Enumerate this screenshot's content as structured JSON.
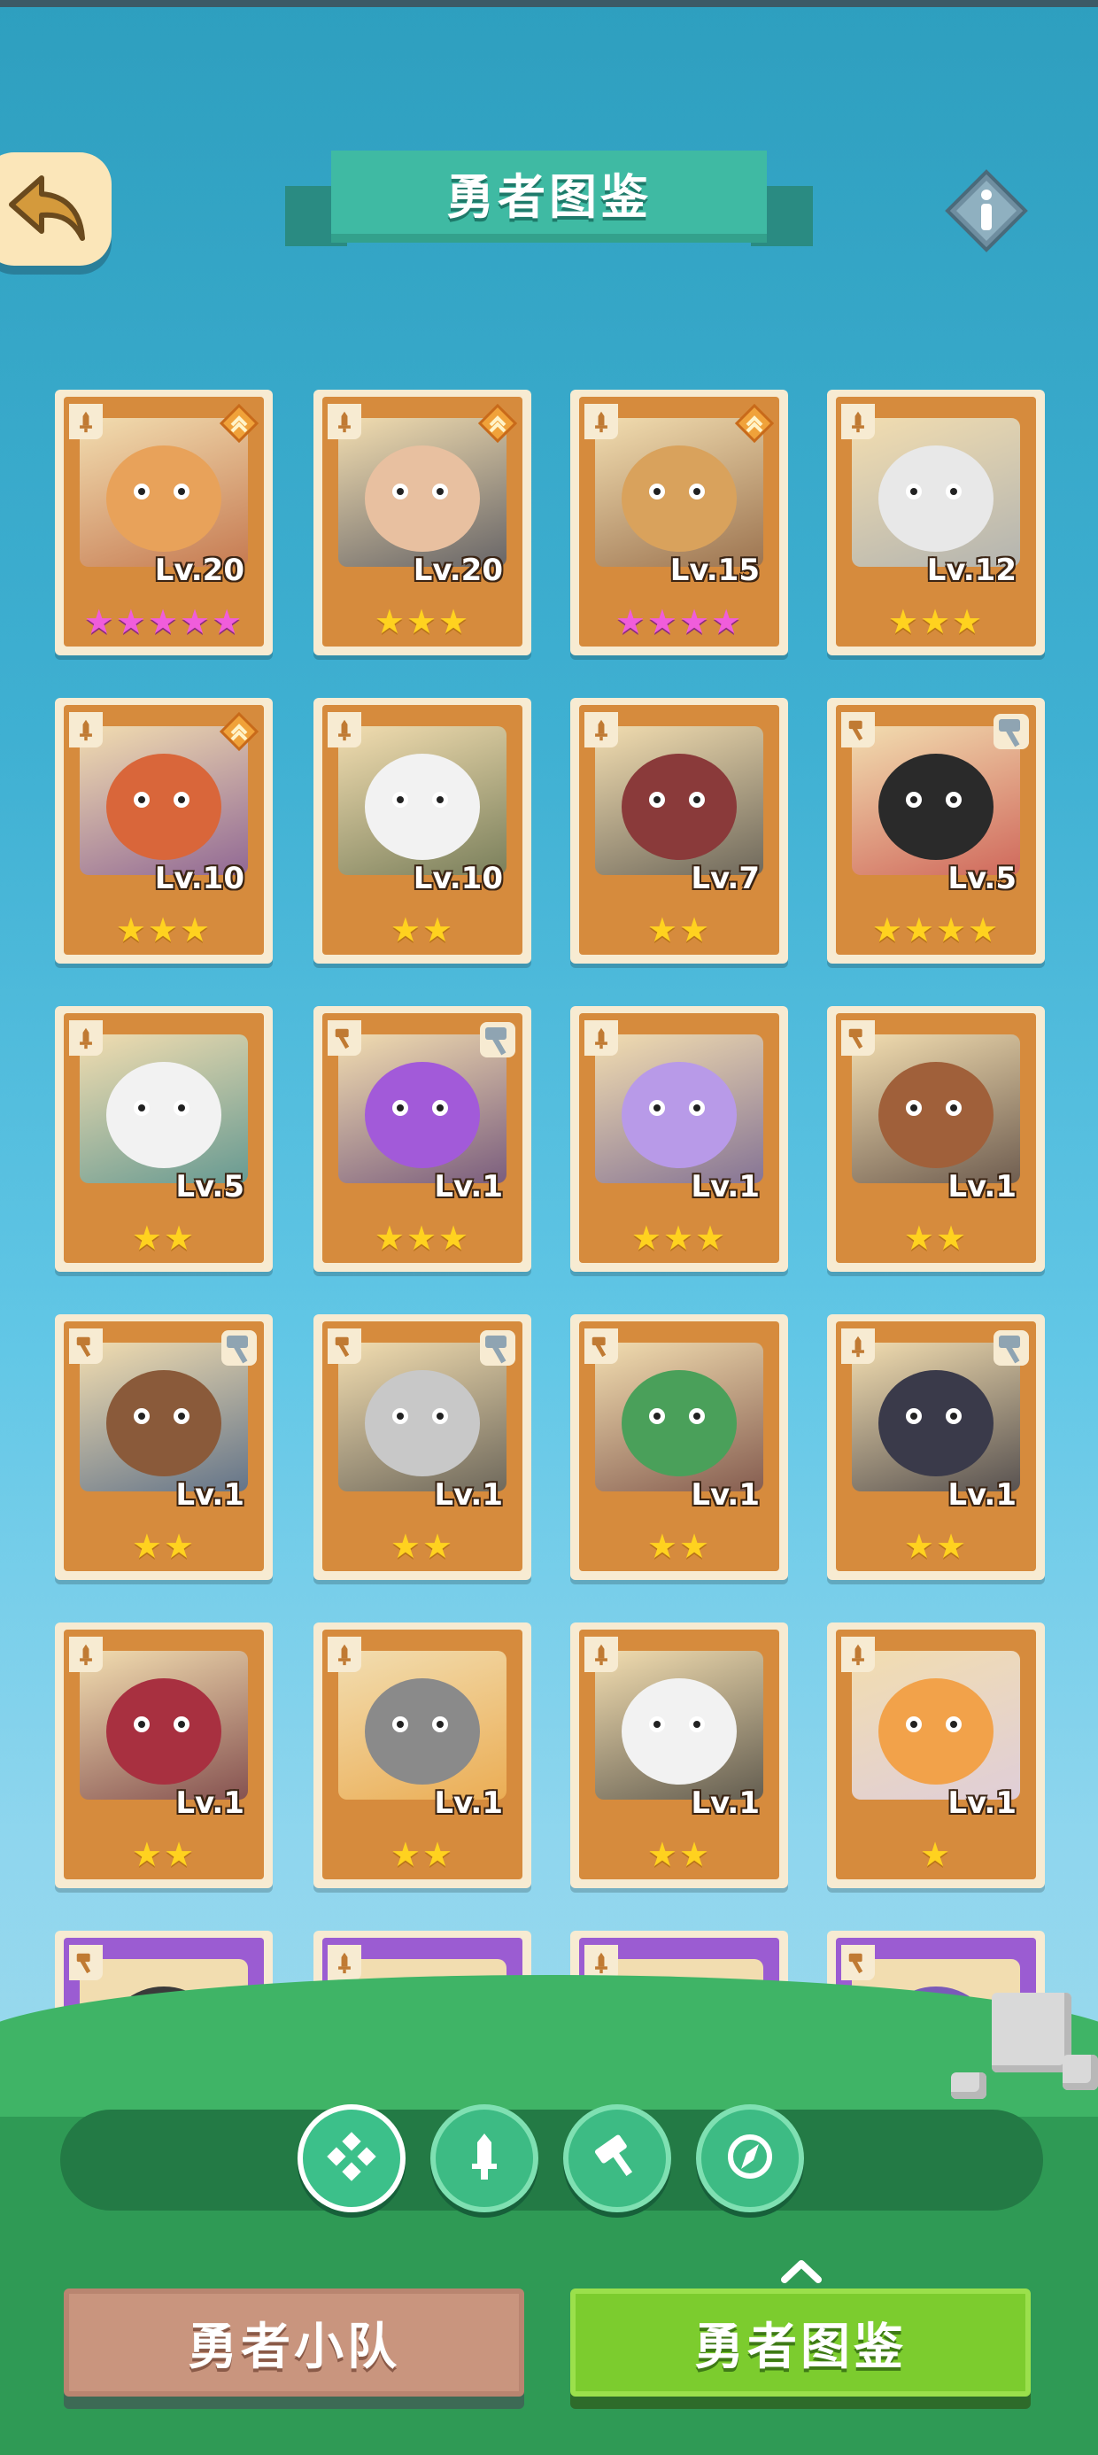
{
  "header": {
    "title": "勇者图鉴"
  },
  "heroes": [
    {
      "level": "Lv.20",
      "stars": 5,
      "star_color": "pink",
      "role": "sword",
      "badge": "rank",
      "palette": [
        "#e8a25a",
        "#b4532c"
      ]
    },
    {
      "level": "Lv.20",
      "stars": 3,
      "star_color": "gold",
      "role": "sword",
      "badge": "rank",
      "palette": [
        "#e8c0a0",
        "#30354a"
      ]
    },
    {
      "level": "Lv.15",
      "stars": 4,
      "star_color": "pink",
      "role": "sword",
      "badge": "rank",
      "palette": [
        "#d9a25c",
        "#7a4a2a"
      ]
    },
    {
      "level": "Lv.12",
      "stars": 3,
      "star_color": "gold",
      "role": "sword",
      "badge": "none",
      "palette": [
        "#e8e8e8",
        "#9aa4b0"
      ]
    },
    {
      "level": "Lv.10",
      "stars": 3,
      "star_color": "gold",
      "role": "sword",
      "badge": "rank",
      "palette": [
        "#d9663a",
        "#6a3a8a"
      ]
    },
    {
      "level": "Lv.10",
      "stars": 2,
      "star_color": "gold",
      "role": "sword",
      "badge": "none",
      "palette": [
        "#f2f2f2",
        "#4a5a3a"
      ]
    },
    {
      "level": "Lv.7",
      "stars": 2,
      "star_color": "gold",
      "role": "sword",
      "badge": "none",
      "palette": [
        "#8a3a3a",
        "#3a3a3a"
      ]
    },
    {
      "level": "Lv.5",
      "stars": 4,
      "star_color": "gold",
      "role": "hammer",
      "badge": "upgrade",
      "palette": [
        "#2a2a2a",
        "#c23a3a"
      ]
    },
    {
      "level": "Lv.5",
      "stars": 2,
      "star_color": "gold",
      "role": "sword",
      "badge": "none",
      "palette": [
        "#f2f2f2",
        "#2f7f86"
      ]
    },
    {
      "level": "Lv.1",
      "stars": 3,
      "star_color": "gold",
      "role": "hammer",
      "badge": "upgrade",
      "palette": [
        "#a25ad9",
        "#4a2a6a"
      ]
    },
    {
      "level": "Lv.1",
      "stars": 3,
      "star_color": "gold",
      "role": "sword",
      "badge": "none",
      "palette": [
        "#b89ae8",
        "#5a4a8a"
      ]
    },
    {
      "level": "Lv.1",
      "stars": 2,
      "star_color": "gold",
      "role": "hammer",
      "badge": "none",
      "palette": [
        "#a0603a",
        "#3a2a2a"
      ]
    },
    {
      "level": "Lv.1",
      "stars": 2,
      "star_color": "gold",
      "role": "hammer",
      "badge": "upgrade",
      "palette": [
        "#8a5a3a",
        "#2a4a7a"
      ]
    },
    {
      "level": "Lv.1",
      "stars": 2,
      "star_color": "gold",
      "role": "hammer",
      "badge": "upgrade",
      "palette": [
        "#c8c8c8",
        "#3a3a3a"
      ]
    },
    {
      "level": "Lv.1",
      "stars": 2,
      "star_color": "gold",
      "role": "hammer",
      "badge": "none",
      "palette": [
        "#4aa05a",
        "#5a2a2a"
      ]
    },
    {
      "level": "Lv.1",
      "stars": 2,
      "star_color": "gold",
      "role": "sword",
      "badge": "upgrade",
      "palette": [
        "#3a3a4a",
        "#1a1a2a"
      ]
    },
    {
      "level": "Lv.1",
      "stars": 2,
      "star_color": "gold",
      "role": "sword",
      "badge": "none",
      "palette": [
        "#a83040",
        "#5a1a2a"
      ]
    },
    {
      "level": "Lv.1",
      "stars": 2,
      "star_color": "gold",
      "role": "sword",
      "badge": "none",
      "palette": [
        "#8a8a8a",
        "#e89a30"
      ]
    },
    {
      "level": "Lv.1",
      "stars": 2,
      "star_color": "gold",
      "role": "sword",
      "badge": "none",
      "palette": [
        "#f2f2f2",
        "#2a2a2a"
      ]
    },
    {
      "level": "Lv.1",
      "stars": 1,
      "star_color": "gold",
      "role": "sword",
      "badge": "none",
      "palette": [
        "#f2a24a",
        "#d8c8e8"
      ]
    }
  ],
  "locked_heroes": [
    {
      "role": "hammer",
      "palette": [
        "#3a3a3a",
        "#d94030"
      ]
    },
    {
      "role": "sword",
      "palette": [
        "#a0603a",
        "#6a3a2a"
      ]
    },
    {
      "role": "sword",
      "palette": [
        "#e8e8e8",
        "#2a2a2a"
      ]
    },
    {
      "role": "hammer",
      "palette": [
        "#7a5ab8",
        "#c8c8c8"
      ]
    }
  ],
  "filters": [
    {
      "icon": "all-classes-icon",
      "active": true
    },
    {
      "icon": "sword-icon",
      "active": false
    },
    {
      "icon": "hammer-icon",
      "active": false
    },
    {
      "icon": "compass-icon",
      "active": false
    }
  ],
  "tabs": {
    "team_label": "勇者小队",
    "codex_label": "勇者图鉴"
  },
  "colors": {
    "accent_green": "#7ccc2e",
    "card_orange": "#d68b3d",
    "card_purple": "#9b5cd2",
    "ribbon_teal": "#3fbaa3"
  }
}
